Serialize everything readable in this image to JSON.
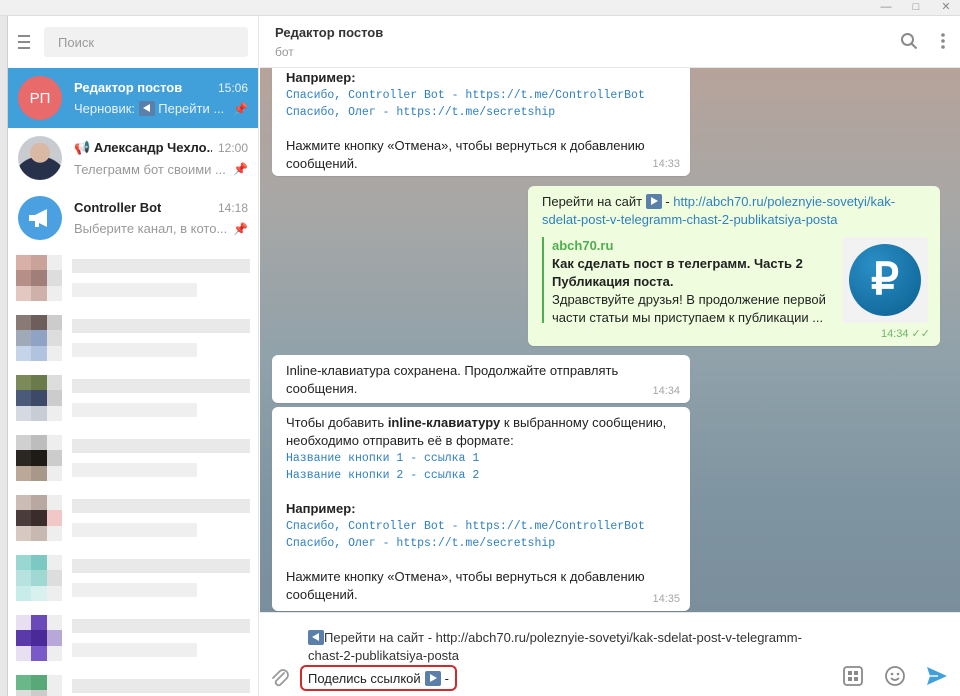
{
  "window": {
    "minimize": "—",
    "maximize": "□",
    "close": "✕"
  },
  "sidebar": {
    "search_placeholder": "Поиск",
    "chats": [
      {
        "avatar_text": "РП",
        "name": "Редактор постов",
        "time": "15:06",
        "draft_label": "Черновик:",
        "preview": " Перейти ...",
        "active": true
      },
      {
        "name": "Александр Чехло...",
        "time": "12:00",
        "preview": "Телеграмм бот своими ...",
        "active": false
      },
      {
        "name": "Controller Bot",
        "time": "14:18",
        "preview": "Выберите канал, в кото...",
        "active": false
      }
    ]
  },
  "header": {
    "title": "Редактор постов",
    "subtitle": "бот"
  },
  "messages": {
    "m1": {
      "example_label": "Например:",
      "code1": "Спасибо, Controller Bot - https://t.me/ControllerBot",
      "code2": "Спасибо, Олег - https://t.me/secretship",
      "cancel_text1": "Нажмите кнопку «Отмена», чтобы вернуться к добавлению",
      "cancel_text2": "сообщений.",
      "time": "14:33"
    },
    "m2": {
      "text_prefix": "Перейти на сайт ",
      "dash": " - ",
      "link1": "http://abch70.ru/poleznyie-sovetyi/kak-",
      "link2": "sdelat-post-v-telegramm-chast-2-publikatsiya-posta",
      "preview_site": "abch70.ru",
      "preview_title1": "Как сделать пост в телеграмм. Часть 2",
      "preview_title2": "Публикация поста.",
      "preview_desc1": "Здравствуйте  друзья! В продолжение первой",
      "preview_desc2": "части статьи мы приступаем к   публикации    ...",
      "preview_image_glyph": "₽",
      "time": "14:34 ✓✓"
    },
    "m3": {
      "line1": "Inline-клавиатура сохранена. Продолжайте отправлять",
      "line2": "сообщения.",
      "time": "14:34"
    },
    "m4": {
      "intro1a": "Чтобы добавить ",
      "intro1b": "inline-клавиатуру",
      "intro1c": " к выбранному сообщению,",
      "intro2": "необходимо отправить её в формате:",
      "fmt1": "Название кнопки 1 - ссылка 1",
      "fmt2": "Название кнопки 2 - ссылка 2",
      "example_label": "Например:",
      "code1": "Спасибо, Controller Bot - https://t.me/ControllerBot",
      "code2": "Спасибо, Олег - https://t.me/secretship",
      "cancel_text1": "Нажмите кнопку «Отмена», чтобы вернуться к добавлению",
      "cancel_text2": "сообщений.",
      "time": "14:35"
    }
  },
  "composer": {
    "draft_line1": "Перейти на сайт  - http://abch70.ru/poleznyie-sovetyi/kak-sdelat-post-v-telegramm-",
    "draft_line2": "chast-2-publikatsiya-posta",
    "input_text": "Поделись ссылкой",
    "input_tail": " -"
  },
  "colors": {
    "accent": "#419fd9",
    "highlight_border": "#d02a2a",
    "outgoing_bubble": "#effdde"
  }
}
